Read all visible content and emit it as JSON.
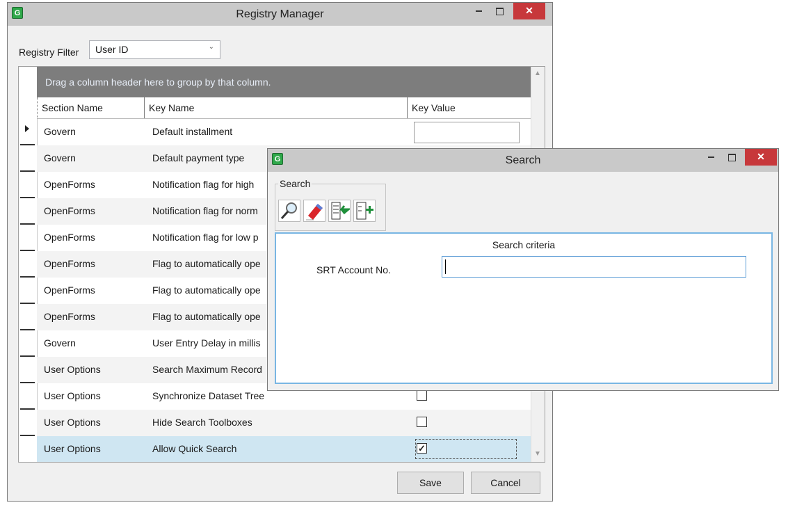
{
  "registry_window": {
    "title": "Registry Manager",
    "icon_letter": "G",
    "filter_label": "Registry Filter",
    "filter_value": "User ID",
    "group_panel_text": "Drag a column header here to group by that column.",
    "columns": [
      "Section Name",
      "Key Name",
      "Key Value"
    ],
    "rows": [
      {
        "section": "Govern",
        "key": "Default installment",
        "value_type": "text",
        "value": ""
      },
      {
        "section": "Govern",
        "key": "Default payment type",
        "value_type": "text",
        "value": ""
      },
      {
        "section": "OpenForms",
        "key": "Notification flag for high",
        "value_type": "none",
        "value": ""
      },
      {
        "section": "OpenForms",
        "key": "Notification flag for norm",
        "value_type": "none",
        "value": ""
      },
      {
        "section": "OpenForms",
        "key": "Notification flag for low p",
        "value_type": "none",
        "value": ""
      },
      {
        "section": "OpenForms",
        "key": "Flag to automatically ope",
        "value_type": "none",
        "value": ""
      },
      {
        "section": "OpenForms",
        "key": "Flag to automatically ope",
        "value_type": "none",
        "value": ""
      },
      {
        "section": "OpenForms",
        "key": "Flag to automatically ope",
        "value_type": "none",
        "value": ""
      },
      {
        "section": "Govern",
        "key": "User Entry Delay in millis",
        "value_type": "none",
        "value": ""
      },
      {
        "section": "User Options",
        "key": "Search Maximum Record",
        "value_type": "none",
        "value": ""
      },
      {
        "section": "User Options",
        "key": "Synchronize Dataset Tree",
        "value_type": "checkbox",
        "checked": false
      },
      {
        "section": "User Options",
        "key": "Hide Search Toolboxes",
        "value_type": "checkbox",
        "checked": false
      },
      {
        "section": "User Options",
        "key": "Allow Quick Search",
        "value_type": "checkbox",
        "checked": true
      }
    ],
    "selected_row_index": 12,
    "current_row_index": 0,
    "save_label": "Save",
    "cancel_label": "Cancel"
  },
  "search_window": {
    "title": "Search",
    "icon_letter": "G",
    "toolbox_label": "Search",
    "tools": [
      "search-icon",
      "eraser-icon",
      "import-criteria-icon",
      "add-criteria-icon"
    ],
    "criteria_title": "Search criteria",
    "field_label": "SRT Account No.",
    "field_value": ""
  },
  "window_controls": {
    "close": "✕"
  },
  "colors": {
    "titlebar": "#c9c9c9",
    "close_button": "#c7383b",
    "group_panel": "#7d7d7d",
    "selected_row": "#cfe6f2",
    "criteria_border": "#79b6e3"
  }
}
